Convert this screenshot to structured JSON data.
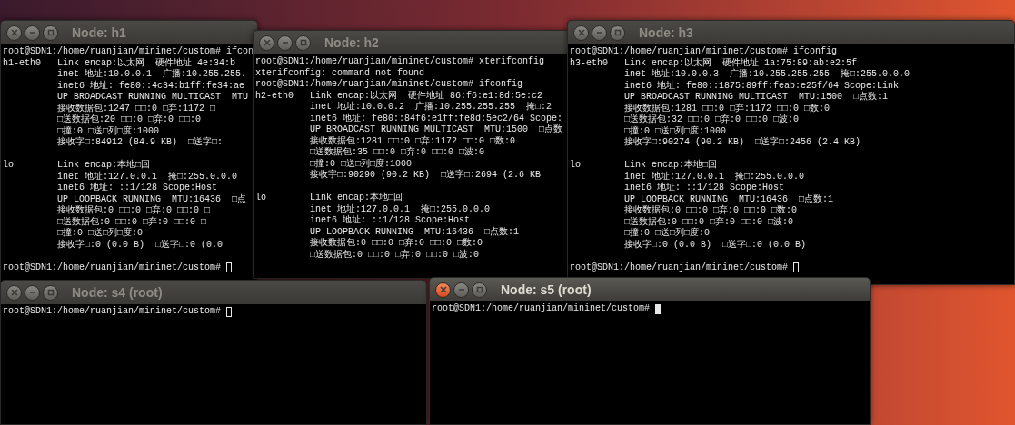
{
  "windows": [
    {
      "title": "Node: h1",
      "focused": false,
      "blocks": [
        [
          "root@SDN1:/home/ruanjian/mininet/custom# ifcon",
          "h1-eth0   Link encap:以太网  硬件地址 4e:34:b",
          "          inet 地址:10.0.0.1  广播:10.255.255.",
          "          inet6 地址: fe80::4c34:b1ff:fe34:ae",
          "          UP BROADCAST RUNNING MULTICAST  MTU",
          "          接收数据包:1247 □□:0 □弃:1172 □",
          "          □送数据包:20 □□:0 □弃:0 □□:0",
          "          □撞:0 □送□列□度:1000",
          "          接收字□:84912 (84.9 KB)  □送字□:"
        ],
        [
          "lo        Link encap:本地□回",
          "          inet 地址:127.0.0.1  掩□:255.0.0.0",
          "          inet6 地址: ::1/128 Scope:Host",
          "          UP LOOPBACK RUNNING  MTU:16436  □点",
          "          接收数据包:0 □□:0 □弃:0 □□:0 □",
          "          □送数据包:0 □□:0 □弃:0 □□:0 □",
          "          □撞:0 □送□列□度:0",
          "          接收字□:0 (0.0 B)  □送字□:0 (0.0"
        ]
      ],
      "prompt": "root@SDN1:/home/ruanjian/mininet/custom# "
    },
    {
      "title": "Node: h2",
      "focused": false,
      "blocks": [
        [
          "root@SDN1:/home/ruanjian/mininet/custom# xterifconfig",
          "xterifconfig: command not found",
          "root@SDN1:/home/ruanjian/mininet/custom# ifconfig",
          "h2-eth0   Link encap:以太网  硬件地址 86:f6:e1:8d:5e:c2",
          "          inet 地址:10.0.0.2  广播:10.255.255.255  掩□:2",
          "          inet6 地址: fe80::84f6:e1ff:fe8d:5ec2/64 Scope:",
          "          UP BROADCAST RUNNING MULTICAST  MTU:1500  □点数",
          "          接收数据包:1281 □□:0 □弃:1172 □□:0 □数:0",
          "          □送数据包:35 □□:0 □弃:0 □□:0 □波:0",
          "          □撞:0 □送□列□度:1000",
          "          接收字□:90290 (90.2 KB)  □送字□:2694 (2.6 KB"
        ],
        [
          "lo        Link encap:本地□回",
          "          inet 地址:127.0.0.1  掩□:255.0.0.0",
          "          inet6 地址: ::1/128 Scope:Host",
          "          UP LOOPBACK RUNNING  MTU:16436  □点数:1",
          "          接收数据包:0 □□:0 □弃:0 □□:0 □数:0",
          "          □送数据包:0 □□:0 □弃:0 □□:0 □波:0"
        ]
      ]
    },
    {
      "title": "Node: h3",
      "focused": false,
      "blocks": [
        [
          "root@SDN1:/home/ruanjian/mininet/custom# ifconfig",
          "h3-eth0   Link encap:以太网  硬件地址 1a:75:89:ab:e2:5f",
          "          inet 地址:10.0.0.3  广播:10.255.255.255  掩□:255.0.0.0",
          "          inet6 地址: fe80::1875:89ff:feab:e25f/64 Scope:Link",
          "          UP BROADCAST RUNNING MULTICAST  MTU:1500  □点数:1",
          "          接收数据包:1281 □□:0 □弃:1172 □□:0 □数:0",
          "          □送数据包:32 □□:0 □弃:0 □□:0 □波:0",
          "          □撞:0 □送□列□度:1000",
          "          接收字□:90274 (90.2 KB)  □送字□:2456 (2.4 KB)"
        ],
        [
          "lo        Link encap:本地□回",
          "          inet 地址:127.0.0.1  掩□:255.0.0.0",
          "          inet6 地址: ::1/128 Scope:Host",
          "          UP LOOPBACK RUNNING  MTU:16436  □点数:1",
          "          接收数据包:0 □□:0 □弃:0 □□:0 □数:0",
          "          □送数据包:0 □□:0 □弃:0 □□:0 □波:0",
          "          □撞:0 □送□列□度:0",
          "          接收字□:0 (0.0 B)  □送字□:0 (0.0 B)"
        ]
      ],
      "prompt": "root@SDN1:/home/ruanjian/mininet/custom# "
    },
    {
      "title": "Node: s4 (root)",
      "focused": false,
      "prompt": "root@SDN1:/home/ruanjian/mininet/custom# "
    },
    {
      "title": "Node: s5 (root)",
      "focused": true,
      "prompt": "root@SDN1:/home/ruanjian/mininet/custom# "
    }
  ]
}
